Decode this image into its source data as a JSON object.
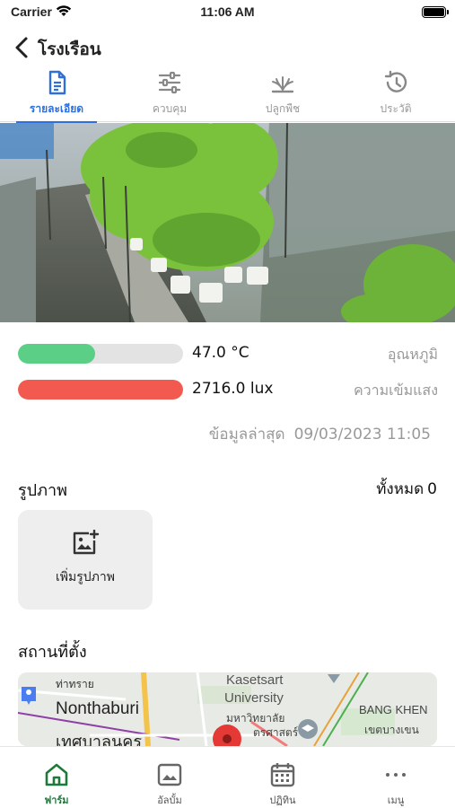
{
  "status_bar": {
    "carrier": "Carrier",
    "time": "11:06 AM"
  },
  "nav": {
    "title": "โรงเรือน"
  },
  "tabs": [
    {
      "label": "รายละเอียด",
      "icon": "document-icon",
      "active": true
    },
    {
      "label": "ควบคุม",
      "icon": "sliders-icon",
      "active": false
    },
    {
      "label": "ปลูกพืช",
      "icon": "plant-icon",
      "active": false
    },
    {
      "label": "ประวัติ",
      "icon": "history-icon",
      "active": false
    }
  ],
  "sensors": [
    {
      "value": "47.0 °C",
      "name": "อุณหภูมิ",
      "level": 0.47,
      "color": "#5ccf86"
    },
    {
      "value": "2716.0 lux",
      "name": "ความเข้มแสง",
      "level": 1.0,
      "color": "#f25a4f"
    }
  ],
  "updated": {
    "label": "ข้อมูลล่าสุด",
    "datetime": "09/03/2023 11:05"
  },
  "images": {
    "title": "รูปภาพ",
    "count_label": "ทั้งหมด",
    "count": "0",
    "add_label": "เพิ่มรูปภาพ"
  },
  "location": {
    "title": "สถานที่ตั้ง",
    "map_labels": {
      "tha_sai": "ท่าทราย",
      "nonthaburi": "Nonthaburi",
      "thesaban": "เทศบาลนคร",
      "kasetsart": "Kasetsart",
      "university": "University",
      "mahawitthayalai": "มหาวิทยาลัย",
      "kasetsat_th": "ตรศาสตร์",
      "bang_khen": "BANG KHEN",
      "khet_bang_khen": "เขตบางเขน"
    }
  },
  "bottom_nav": [
    {
      "label": "ฟาร์ม",
      "icon": "home-icon",
      "active": true
    },
    {
      "label": "อัลบั้ม",
      "icon": "album-icon",
      "active": false
    },
    {
      "label": "ปฏิทิน",
      "icon": "calendar-icon",
      "active": false
    },
    {
      "label": "เมนู",
      "icon": "more-icon",
      "active": false
    }
  ],
  "colors": {
    "accent": "#2f6fdb",
    "farm_green": "#1f7a3a",
    "temp_bar": "#5ccf86",
    "light_bar": "#f25a4f"
  }
}
